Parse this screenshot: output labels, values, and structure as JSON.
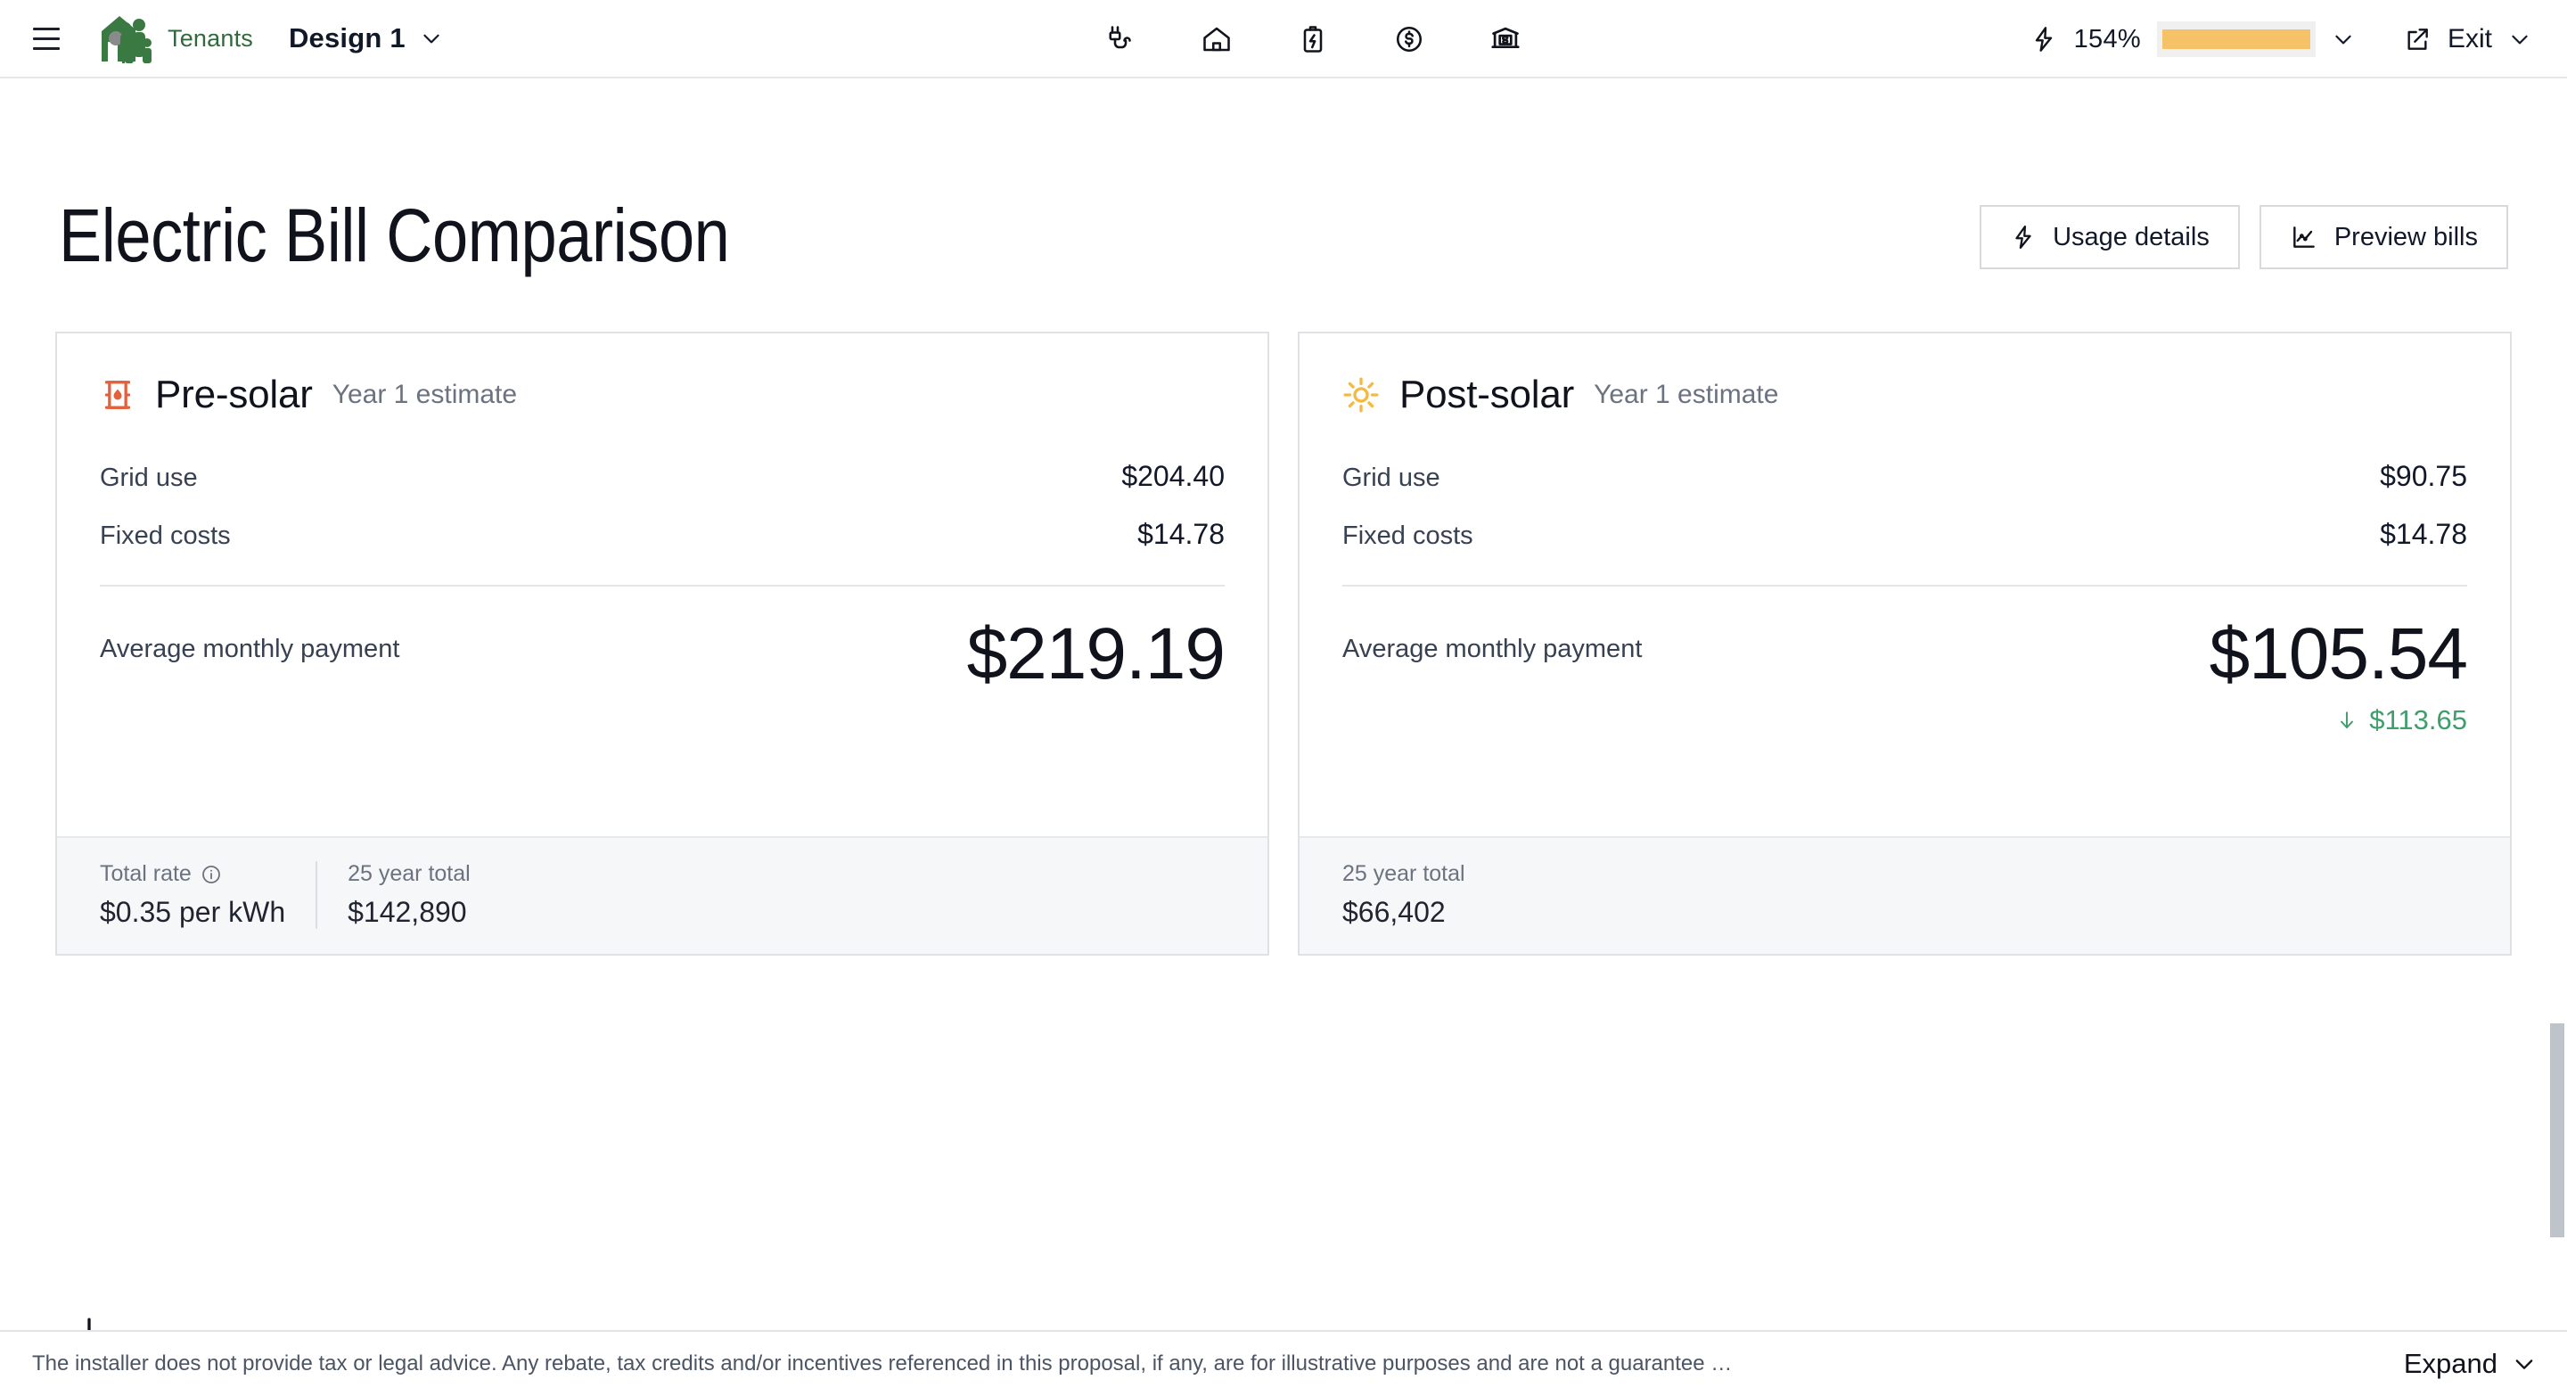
{
  "appbar": {
    "menu_icon": "hamburger-menu-icon",
    "brand": {
      "name": "Tenants",
      "logo_icon": "tenants-house-family-logo",
      "color": "#2f6b3a"
    },
    "design_selector": {
      "label": "Design 1",
      "chevron_icon": "chevron-down-icon"
    },
    "nav_icons": [
      {
        "name": "plug-icon",
        "title": "Utility connection"
      },
      {
        "name": "home-icon",
        "title": "Home"
      },
      {
        "name": "battery-charging-icon",
        "title": "Storage"
      },
      {
        "name": "dollar-circle-icon",
        "title": "Savings"
      },
      {
        "name": "bank-money-icon",
        "title": "Financing"
      }
    ],
    "offset": {
      "bolt_icon": "lightning-bolt-icon",
      "percent": "154%",
      "bar_fill_color": "#f5c268",
      "bar_value": 100,
      "chevron_icon": "chevron-down-icon"
    },
    "exit": {
      "label": "Exit",
      "icon": "exit-arrow-icon",
      "chevron_icon": "chevron-down-icon"
    }
  },
  "page": {
    "title": "Electric Bill Comparison",
    "actions": [
      {
        "label": "Usage details",
        "icon": "lightning-bolt-icon"
      },
      {
        "label": "Preview bills",
        "icon": "line-chart-icon"
      }
    ],
    "scroll_hint_icon": "arrow-down-icon"
  },
  "cards": {
    "pre": {
      "icon": "oil-barrel-icon",
      "icon_color": "#e2623d",
      "title": "Pre-solar",
      "subtitle": "Year 1 estimate",
      "lines": [
        {
          "label": "Grid use",
          "value": "$204.40"
        },
        {
          "label": "Fixed costs",
          "value": "$14.78"
        }
      ],
      "average_label": "Average monthly payment",
      "average_value": "$219.19",
      "footer": [
        {
          "label": "Total rate",
          "info_icon": "info-icon",
          "value": "$0.35 per kWh"
        },
        {
          "label": "25 year total",
          "value": "$142,890"
        }
      ]
    },
    "post": {
      "icon": "sun-icon",
      "icon_color": "#f5b942",
      "title": "Post-solar",
      "subtitle": "Year 1 estimate",
      "lines": [
        {
          "label": "Grid use",
          "value": "$90.75"
        },
        {
          "label": "Fixed costs",
          "value": "$14.78"
        }
      ],
      "average_label": "Average monthly payment",
      "average_value": "$105.54",
      "savings": {
        "arrow_icon": "arrow-down-icon",
        "amount": "$113.65",
        "color": "#3f9e6b"
      },
      "footer": [
        {
          "label": "25 year total",
          "value": "$66,402"
        }
      ]
    }
  },
  "footer": {
    "disclaimer": "The installer does not provide tax or legal advice. Any rebate, tax credits and/or incentives referenced in this proposal, if any, are for illustrative purposes and are not a guarantee …",
    "expand": {
      "label": "Expand",
      "chevron_icon": "chevron-down-icon"
    }
  }
}
